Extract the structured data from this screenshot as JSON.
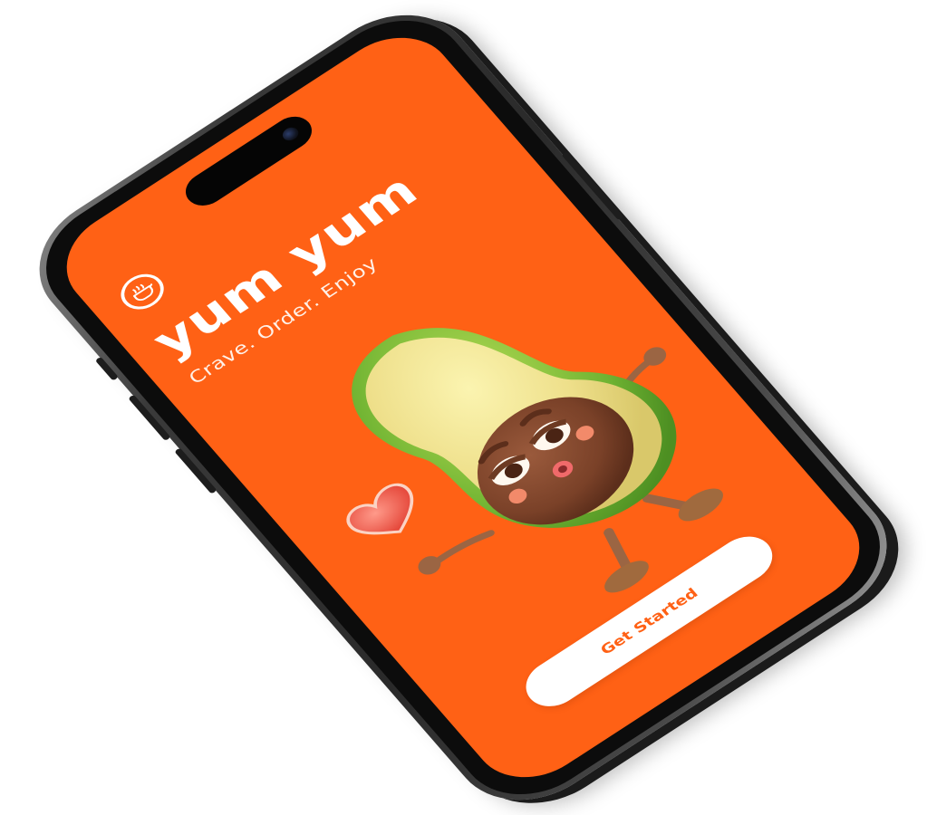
{
  "app": {
    "title": "yum yum",
    "tagline": "Crave. Order. Enjoy"
  },
  "actions": {
    "get_started_label": "Get Started"
  },
  "icons": {
    "logo": "cooking-pot-icon",
    "decoration": "heart-icon"
  },
  "colors": {
    "screen_background": "#ff6115",
    "button_background": "#ffffff",
    "button_text": "#ff6115",
    "title_text": "#ffffff"
  }
}
